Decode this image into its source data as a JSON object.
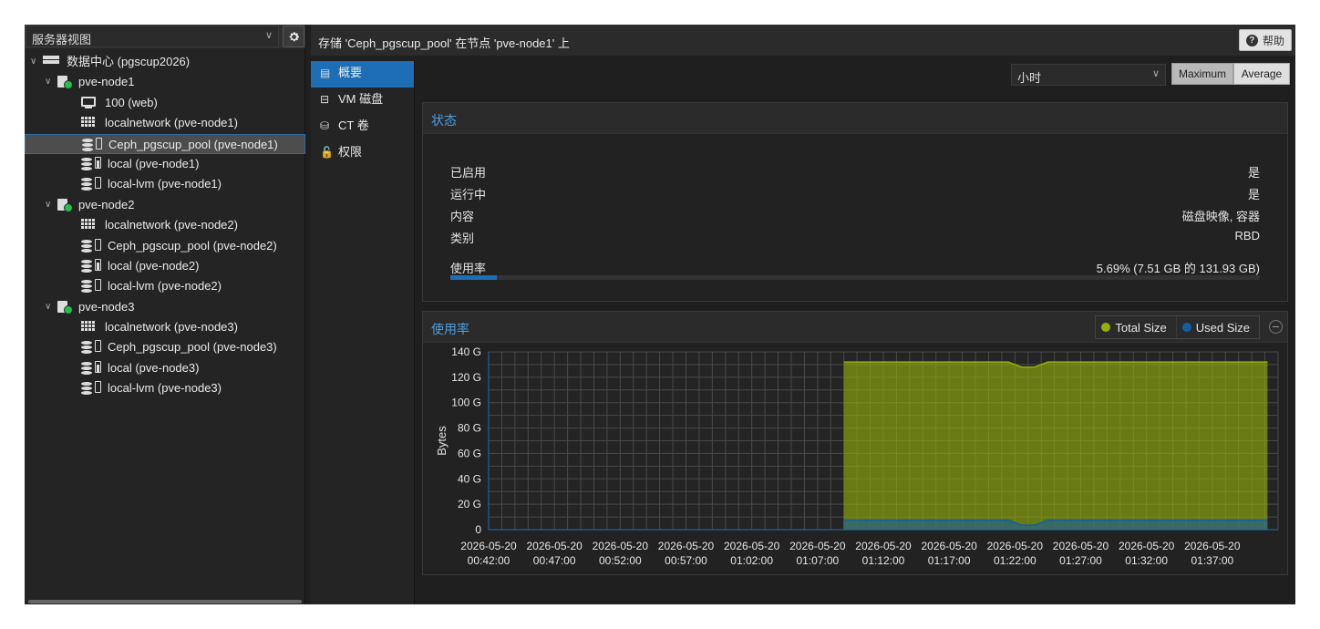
{
  "tree": {
    "view_label": "服务器视图",
    "items": [
      {
        "label": "数据中心 (pgscup2026)",
        "icon": "server-icon",
        "level": 0,
        "twisty": "down"
      },
      {
        "label": "pve-node1",
        "icon": "node-online-icon",
        "level": 1,
        "twisty": "down"
      },
      {
        "label": "100 (web)",
        "icon": "monitor-icon",
        "level": 2
      },
      {
        "label": "localnetwork (pve-node1)",
        "icon": "network-grid-icon",
        "level": 2
      },
      {
        "label": "Ceph_pgscup_pool (pve-node1)",
        "icon": "storage-icon",
        "level": 2,
        "selected": true
      },
      {
        "label": "local (pve-node1)",
        "icon": "storage-icon",
        "level": 2,
        "usage": "full"
      },
      {
        "label": "local-lvm (pve-node1)",
        "icon": "storage-icon",
        "level": 2
      },
      {
        "label": "pve-node2",
        "icon": "node-online-icon",
        "level": 1,
        "twisty": "down"
      },
      {
        "label": "localnetwork (pve-node2)",
        "icon": "network-grid-icon",
        "level": 2
      },
      {
        "label": "Ceph_pgscup_pool (pve-node2)",
        "icon": "storage-icon",
        "level": 2
      },
      {
        "label": "local (pve-node2)",
        "icon": "storage-icon",
        "level": 2,
        "usage": "full"
      },
      {
        "label": "local-lvm (pve-node2)",
        "icon": "storage-icon",
        "level": 2
      },
      {
        "label": "pve-node3",
        "icon": "node-online-icon",
        "level": 1,
        "twisty": "down"
      },
      {
        "label": "localnetwork (pve-node3)",
        "icon": "network-grid-icon",
        "level": 2
      },
      {
        "label": "Ceph_pgscup_pool (pve-node3)",
        "icon": "storage-icon",
        "level": 2
      },
      {
        "label": "local (pve-node3)",
        "icon": "storage-icon",
        "level": 2,
        "usage": "full"
      },
      {
        "label": "local-lvm (pve-node3)",
        "icon": "storage-icon",
        "level": 2
      }
    ]
  },
  "header": {
    "title": "存储 'Ceph_pgscup_pool' 在节点 'pve-node1' 上",
    "help_label": "帮助"
  },
  "nav": [
    {
      "label": "概要",
      "icon": "book-icon",
      "active": true
    },
    {
      "label": "VM 磁盘",
      "icon": "hdd-icon"
    },
    {
      "label": "CT 卷",
      "icon": "ct-volume-icon"
    },
    {
      "label": "权限",
      "icon": "unlock-icon"
    }
  ],
  "toolbar": {
    "timeframe": "小时",
    "max_label": "Maximum",
    "avg_label": "Average"
  },
  "status": {
    "title": "状态",
    "rows": [
      {
        "key": "已启用",
        "value": "是"
      },
      {
        "key": "运行中",
        "value": "是"
      },
      {
        "key": "内容",
        "value": "磁盘映像, 容器"
      },
      {
        "key": "类别",
        "value": "RBD"
      }
    ],
    "usage_label": "使用率",
    "usage_value": "5.69% (7.51 GB 的 131.93 GB)",
    "usage_fraction": 0.0569
  },
  "usage_panel": {
    "title": "使用率",
    "legend": [
      {
        "label": "Total Size",
        "color": "#94ae0a"
      },
      {
        "label": "Used Size",
        "color": "#115fa6"
      }
    ]
  },
  "colors": {
    "accent": "#1d6eb5",
    "title_blue": "#4a9fe0",
    "online": "#21bf4b"
  },
  "chart_data": {
    "type": "area",
    "ylabel": "Bytes",
    "ylim": [
      0,
      140
    ],
    "yticks": [
      "0",
      "20 G",
      "40 G",
      "60 G",
      "80 G",
      "100 G",
      "120 G",
      "140 G"
    ],
    "xlim_minutes": [
      0,
      60
    ],
    "xticks": [
      {
        "m": 0,
        "date": "2026-05-20",
        "time": "00:42:00"
      },
      {
        "m": 5,
        "date": "2026-05-20",
        "time": "00:47:00"
      },
      {
        "m": 10,
        "date": "2026-05-20",
        "time": "00:52:00"
      },
      {
        "m": 15,
        "date": "2026-05-20",
        "time": "00:57:00"
      },
      {
        "m": 20,
        "date": "2026-05-20",
        "time": "01:02:00"
      },
      {
        "m": 25,
        "date": "2026-05-20",
        "time": "01:07:00"
      },
      {
        "m": 30,
        "date": "2026-05-20",
        "time": "01:12:00"
      },
      {
        "m": 35,
        "date": "2026-05-20",
        "time": "01:17:00"
      },
      {
        "m": 40,
        "date": "2026-05-20",
        "time": "01:22:00"
      },
      {
        "m": 45,
        "date": "2026-05-20",
        "time": "01:27:00"
      },
      {
        "m": 50,
        "date": "2026-05-20",
        "time": "01:32:00"
      },
      {
        "m": 55,
        "date": "2026-05-20",
        "time": "01:37:00"
      }
    ],
    "series": [
      {
        "name": "Total Size",
        "color": "#94ae0a",
        "points": [
          [
            27,
            132
          ],
          [
            39.5,
            132
          ],
          [
            40.5,
            128
          ],
          [
            41.5,
            128
          ],
          [
            42.5,
            132
          ],
          [
            59.2,
            132
          ]
        ]
      },
      {
        "name": "Used Size",
        "color": "#115fa6",
        "points": [
          [
            27,
            7.5
          ],
          [
            39.5,
            7.5
          ],
          [
            40.5,
            3.5
          ],
          [
            41.5,
            3.5
          ],
          [
            42.5,
            7.5
          ],
          [
            59.2,
            7.5
          ]
        ]
      }
    ]
  }
}
